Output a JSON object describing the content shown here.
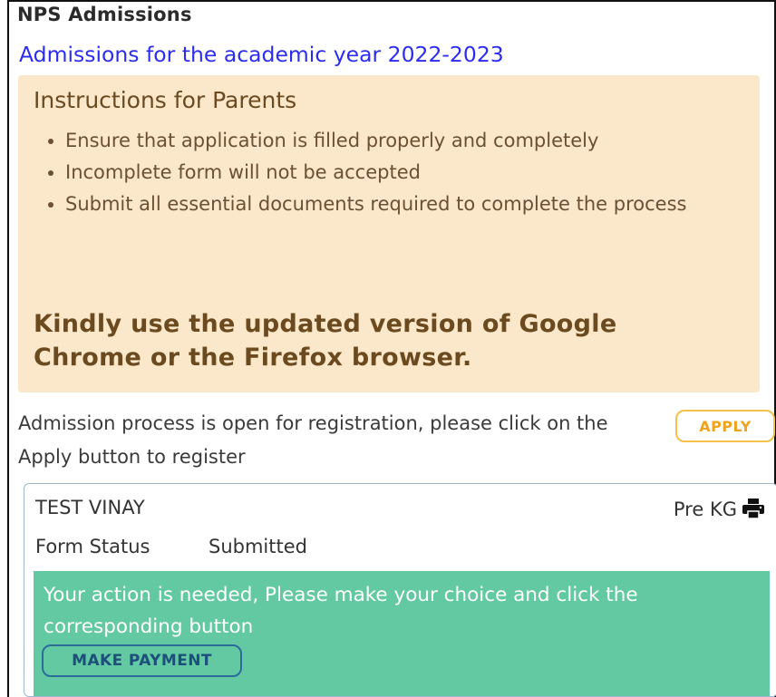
{
  "header": {
    "app_title": "NPS Admissions",
    "subtitle": "Admissions for the academic year 2022-2023"
  },
  "instructions": {
    "title": "Instructions for Parents",
    "items": [
      "Ensure that application is filled properly and completely",
      "Incomplete form will not be accepted",
      "Submit all essential documents required to complete the process"
    ],
    "browser_notice": "Kindly use the updated version of Google Chrome or the Firefox browser."
  },
  "registration": {
    "message": "Admission process is open for registration, please click on the Apply button to register",
    "apply_label": "APPLY"
  },
  "application": {
    "student_name": "TEST VINAY",
    "class": "Pre KG",
    "print_icon": "printer-icon",
    "status_label": "Form Status",
    "status_value": "Submitted",
    "action_message": "Your action is needed, Please make your choice and click the corresponding button",
    "payment_label": "MAKE PAYMENT"
  },
  "colors": {
    "instructions_bg": "#fbe7c9",
    "subtitle": "#2c2cf0",
    "apply_border": "#f5c14a",
    "action_bg": "#63c9a3",
    "payment_border": "#2b6b9a"
  }
}
